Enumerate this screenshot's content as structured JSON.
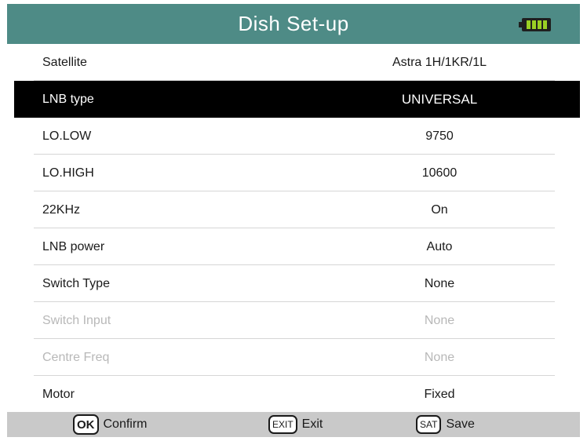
{
  "header": {
    "title": "Dish Set-up",
    "battery_icon": "battery-full-icon",
    "battery_color": "#9ad024",
    "battery_level": 1.0
  },
  "rows": [
    {
      "label": "Satellite",
      "value": "Astra 1H/1KR/1L"
    },
    {
      "label": "LNB type",
      "value": "UNIVERSAL"
    },
    {
      "label": "LO.LOW",
      "value": "9750"
    },
    {
      "label": "LO.HIGH",
      "value": "10600"
    },
    {
      "label": "22KHz",
      "value": "On"
    },
    {
      "label": "LNB power",
      "value": "Auto"
    },
    {
      "label": "Switch Type",
      "value": "None"
    },
    {
      "label": "Switch Input",
      "value": "None"
    },
    {
      "label": "Centre Freq",
      "value": "None"
    },
    {
      "label": "Motor",
      "value": "Fixed"
    }
  ],
  "footer": {
    "ok_key": "OK",
    "ok_label": "Confirm",
    "exit_key": "EXIT",
    "exit_label": "Exit",
    "sat_key": "SAT",
    "sat_label": "Save"
  },
  "colors": {
    "header": "#4e8b86",
    "selected_row": "#000000",
    "footer": "#c9c9c9",
    "disabled_text": "#b8b8b8"
  }
}
